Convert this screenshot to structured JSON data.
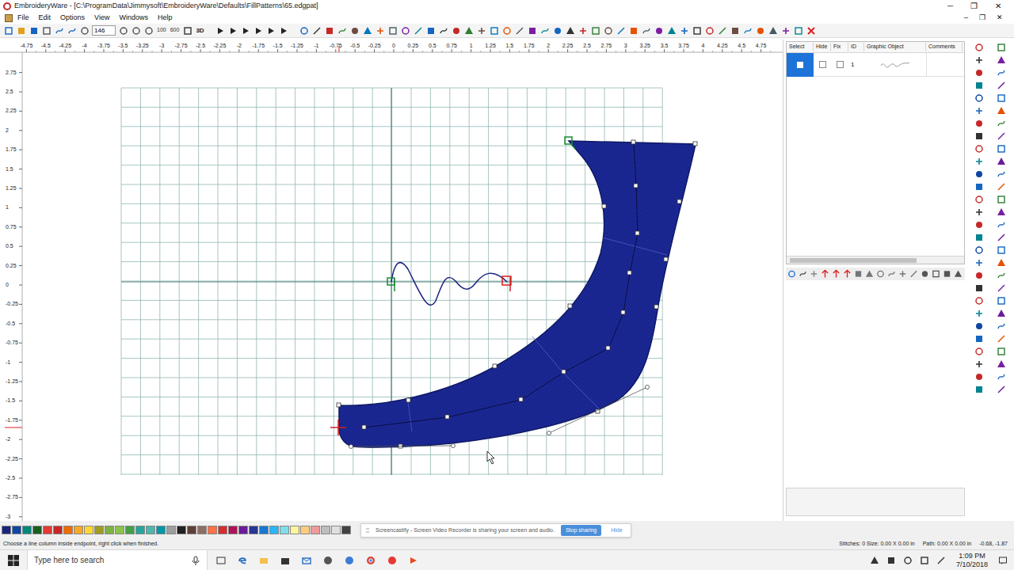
{
  "window": {
    "title": "EmbroideryWare - [C:\\ProgramData\\Jimmysoft\\EmbroideryWare\\Defaults\\FillPatterns\\65.edgpat]",
    "controls": [
      "─",
      "❐",
      "✕"
    ],
    "doc_controls": [
      "–",
      "❐",
      "✕"
    ]
  },
  "menu": [
    "File",
    "Edit",
    "Options",
    "View",
    "Windows",
    "Help"
  ],
  "toolbar": {
    "zoom": "146",
    "buttons": [
      "100",
      "600",
      "3D"
    ]
  },
  "rulers": {
    "horizontal": [
      "-4.75",
      "-4.5",
      "-4.25",
      "-4",
      "-3.75",
      "-3.5",
      "-3.25",
      "-3",
      "-2.75",
      "-2.5",
      "-2.25",
      "-2",
      "-1.75",
      "-1.5",
      "-1.25",
      "-1",
      "-0.75",
      "-0.5",
      "-0.25",
      "0",
      "0.25",
      "0.5",
      "0.75",
      "1",
      "1.25",
      "1.5",
      "1.75",
      "2",
      "2.25",
      "2.5",
      "2.75",
      "3",
      "3.25",
      "3.5",
      "3.75",
      "4",
      "4.25",
      "4.5",
      "4.75"
    ],
    "vertical": [
      "2.75",
      "2.5",
      "2.25",
      "2",
      "1.75",
      "1.5",
      "1.25",
      "1",
      "0.75",
      "0.5",
      "0.25",
      "0",
      "-0.25",
      "-0.5",
      "-0.75",
      "-1",
      "-1.25",
      "-1.5",
      "-1.75",
      "-2",
      "-2.25",
      "-2.5",
      "-2.75",
      "-3"
    ]
  },
  "layers": {
    "columns": [
      "Select",
      "Hide",
      "Fix",
      "ID",
      "Graphic Object",
      "Comments"
    ],
    "rows": [
      {
        "id": "1",
        "selected": true,
        "hidden": false,
        "fixed": false
      }
    ]
  },
  "palette": [
    {
      "color": "#1a237e"
    },
    {
      "color": "#0d47a1"
    },
    {
      "color": "#00897b"
    },
    {
      "color": "#1b5e20"
    },
    {
      "color": "#e53935"
    },
    {
      "color": "#c62828"
    },
    {
      "color": "#ef6c00"
    },
    {
      "color": "#f9a825"
    },
    {
      "color": "#fdd835"
    },
    {
      "color": "#9e9d24"
    },
    {
      "color": "#7cb342"
    },
    {
      "color": "#8bc34a"
    },
    {
      "color": "#43a047"
    },
    {
      "color": "#26a69a"
    },
    {
      "color": "#4db6ac"
    },
    {
      "color": "#0097a7"
    },
    {
      "color": "#9e9e9e"
    },
    {
      "color": "#212121"
    },
    {
      "color": "#5d4037"
    },
    {
      "color": "#8d6e63"
    },
    {
      "color": "#ff7043"
    },
    {
      "color": "#d32f2f"
    },
    {
      "color": "#ad1457"
    },
    {
      "color": "#6a1b9a"
    },
    {
      "color": "#283593"
    },
    {
      "color": "#1976d2"
    },
    {
      "color": "#29b6f6"
    },
    {
      "color": "#80deea"
    },
    {
      "color": "#fff59d"
    },
    {
      "color": "#ffcc80"
    },
    {
      "color": "#ef9a9a"
    },
    {
      "color": "#bdbdbd"
    },
    {
      "color": "#e0e0e0"
    },
    {
      "color": "#424242"
    }
  ],
  "status_bar": {
    "prompt": "Choose a line column inside endpoint, right click when finished.",
    "stitches": "Stitches: 0 Size: 0.00 X 0.00 in",
    "path": "Path: 0.00 X 0.00 in",
    "coords": "-0.68, -1.87"
  },
  "screencastify": {
    "message": "Screencastify - Screen Video Recorder is sharing your screen and audio.",
    "stop": "Stop sharing",
    "hide": "Hide"
  },
  "taskbar": {
    "search": "Type here to search",
    "time": "1:09 PM",
    "date": "7/10/2018"
  }
}
